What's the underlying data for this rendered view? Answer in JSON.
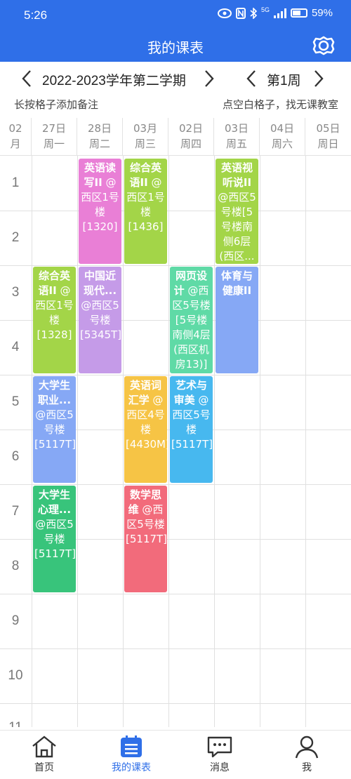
{
  "status_bar": {
    "time": "5:26",
    "network": "5G",
    "battery": "59%"
  },
  "header": {
    "title": "我的课表",
    "settings_icon": "gear-icon"
  },
  "selector": {
    "semester": "2022-2023学年第二学期",
    "week": "第1周"
  },
  "hints": {
    "left": "长按格子添加备注",
    "right": "点空白格子，找无课教室"
  },
  "grid": {
    "month": {
      "num": "02",
      "unit": "月"
    },
    "days": [
      {
        "date": "27日",
        "weekday": "周一"
      },
      {
        "date": "28日",
        "weekday": "周二"
      },
      {
        "date": "03月",
        "weekday": "周三"
      },
      {
        "date": "02日",
        "weekday": "周四"
      },
      {
        "date": "03日",
        "weekday": "周五"
      },
      {
        "date": "04日",
        "weekday": "周六"
      },
      {
        "date": "05日",
        "weekday": "周日"
      }
    ],
    "periods": [
      "1",
      "2",
      "3",
      "4",
      "5",
      "6",
      "7",
      "8",
      "9",
      "10",
      "11"
    ]
  },
  "courses": [
    {
      "name": "英语读写II",
      "location": "@ 西区1号楼[1320]",
      "color": "#e97fd6"
    },
    {
      "name": "综合英语II",
      "location": "@ 西区1号楼[1436]",
      "color": "#a3d548"
    },
    {
      "name": "英语视听说II",
      "location": "@西区5号楼[5号楼南侧6层(西区...",
      "color": "#a3d548"
    },
    {
      "name": "综合英语II",
      "location": "@ 西区1号楼[1328]",
      "color": "#a3d548"
    },
    {
      "name": "中国近现代...",
      "location": "@西区5号楼[5345T]",
      "color": "#c59be8"
    },
    {
      "name": "网页设计",
      "location": "@西区5号楼[5号楼南侧4层(西区机房13)]",
      "color": "#5fdaa6"
    },
    {
      "name": "体育与健康II",
      "location": "",
      "color": "#86a8f5"
    },
    {
      "name": "大学生职业...",
      "location": "@西区5号楼[5117T]",
      "color": "#86a8f5"
    },
    {
      "name": "英语词汇学",
      "location": "@ 西区4号楼[4430M]",
      "color": "#f6c445"
    },
    {
      "name": "艺术与审美",
      "location": "@ 西区5号楼[5117T]",
      "color": "#47b8ef"
    },
    {
      "name": "大学生心理...",
      "location": "@西区5号楼[5117T]",
      "color": "#38c47b"
    },
    {
      "name": "数学思维",
      "location": "@西区5号楼[5117T]",
      "color": "#f26b7b"
    }
  ],
  "bottom_nav": [
    {
      "label": "首页",
      "icon": "home-icon"
    },
    {
      "label": "我的课表",
      "icon": "timetable-icon"
    },
    {
      "label": "消息",
      "icon": "message-icon"
    },
    {
      "label": "我",
      "icon": "profile-icon"
    }
  ],
  "colors": {
    "primary": "#2f6fe8"
  }
}
